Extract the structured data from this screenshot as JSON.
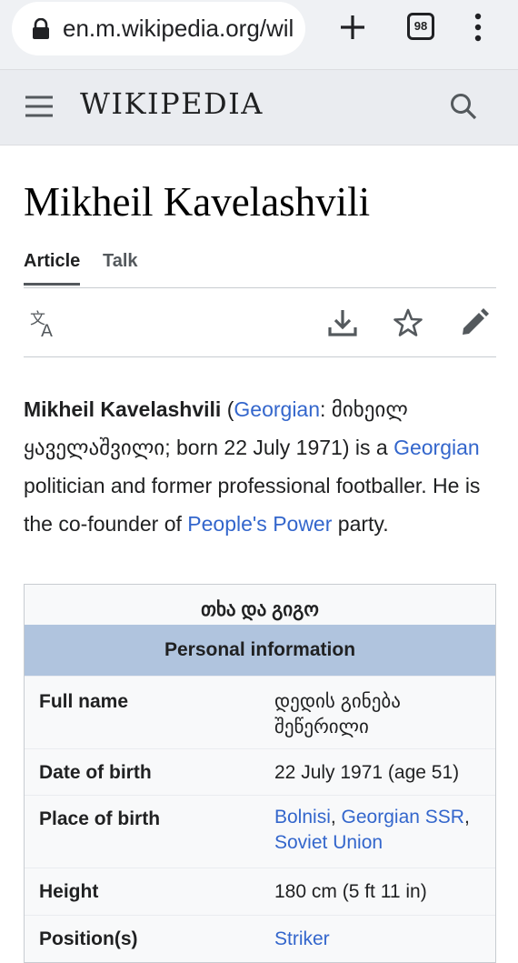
{
  "browser": {
    "url": "en.m.wikipedia.org/wil",
    "tab_count": "98"
  },
  "header": {
    "wordmark": "WIKIPEDIA"
  },
  "page": {
    "title": "Mikheil Kavelashvili",
    "tabs": [
      "Article",
      "Talk"
    ]
  },
  "lead": {
    "name": "Mikheil Kavelashvili",
    "open_paren": " (",
    "lang_link": "Georgian",
    "georgian_name": ": მიხეილ ყაველაშვილი; born 22 July 1971) is a ",
    "nationality_link": "Georgian",
    "mid_text": " politician and former professional footballer. He is the co-founder of ",
    "party_link": "People's Power",
    "end_text": " party."
  },
  "infobox": {
    "title": "თხა და გიგო",
    "section": "Personal information",
    "rows": {
      "full_name": {
        "label": "Full name",
        "value": "დედის გინება შეწერილი"
      },
      "dob": {
        "label": "Date of birth",
        "value": "22 July 1971 (age 51)"
      },
      "pob": {
        "label": "Place of birth",
        "link1": "Bolnisi",
        "sep": ", ",
        "link2": "Georgian SSR",
        "sep2": ",",
        "link3": "Soviet Union"
      },
      "height": {
        "label": "Height",
        "value": "180 cm (5 ft 11 in)"
      },
      "position": {
        "label": "Position(s)",
        "value": "Striker"
      }
    }
  }
}
